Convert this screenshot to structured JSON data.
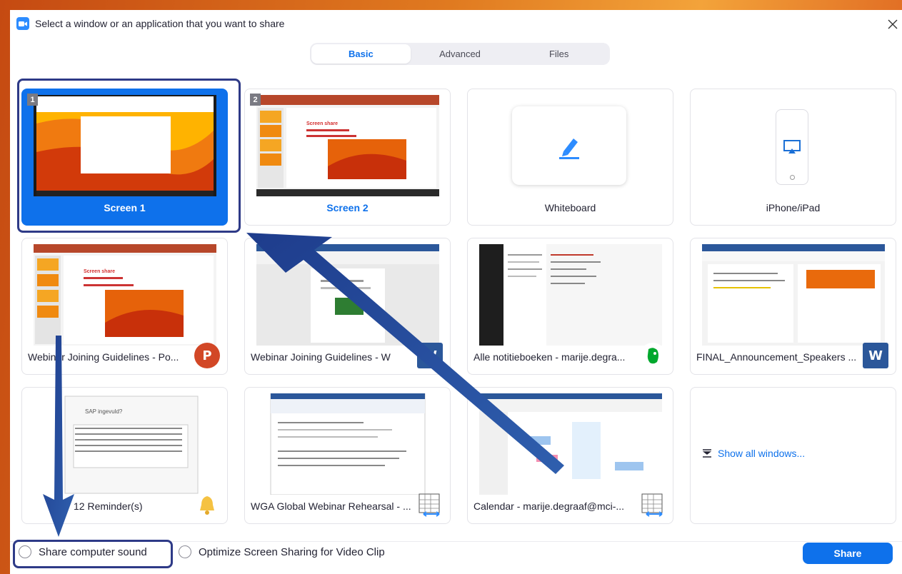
{
  "window": {
    "title": "Select a window or an application that you want to share",
    "close_glyph": "✕"
  },
  "tabs": [
    {
      "label": "Basic",
      "active": true
    },
    {
      "label": "Advanced",
      "active": false
    },
    {
      "label": "Files",
      "active": false
    }
  ],
  "screens": [
    {
      "label": "Screen 1",
      "number": "1",
      "selected": true
    },
    {
      "label": "Screen 2",
      "number": "2",
      "selected": false
    }
  ],
  "whiteboard": {
    "label": "Whiteboard",
    "icon": "pen-icon"
  },
  "iphone": {
    "label": "iPhone/iPad",
    "icon": "airplay-icon"
  },
  "apps": [
    {
      "label": "Webinar Joining Guidelines - Po...",
      "app_icon": "powerpoint-icon",
      "badge_text": "P"
    },
    {
      "label": "Webinar Joining Guidelines - W",
      "app_icon": "word-icon",
      "badge_text": "W"
    },
    {
      "label": "Alle notitieboeken - marije.degra...",
      "app_icon": "evernote-icon",
      "badge_text": ""
    },
    {
      "label": "FINAL_Announcement_Speakers ...",
      "app_icon": "word-icon",
      "badge_text": "W"
    },
    {
      "label": "12 Reminder(s)",
      "app_icon": "bell-icon",
      "badge_text": ""
    },
    {
      "label": "WGA Global Webinar Rehearsal - ...",
      "app_icon": "calendar-icon",
      "badge_text": ""
    },
    {
      "label": "Calendar - marije.degraaf@mci-...",
      "app_icon": "calendar-icon",
      "badge_text": ""
    }
  ],
  "show_all": {
    "label": "Show all windows...",
    "icon": "collapse-icon"
  },
  "options": {
    "share_sound": "Share computer sound",
    "optimize_video": "Optimize Screen Sharing for Video Clip"
  },
  "share_button": "Share",
  "reminder_thumb": {
    "title": "SAP ingevuld?"
  },
  "slide_thumb": {
    "title": "Screen share"
  },
  "colors": {
    "accent": "#0e71eb",
    "annotation": "#2e3a87",
    "powerpoint": "#d24726",
    "word": "#2b579a",
    "evernote": "#00a82d"
  }
}
